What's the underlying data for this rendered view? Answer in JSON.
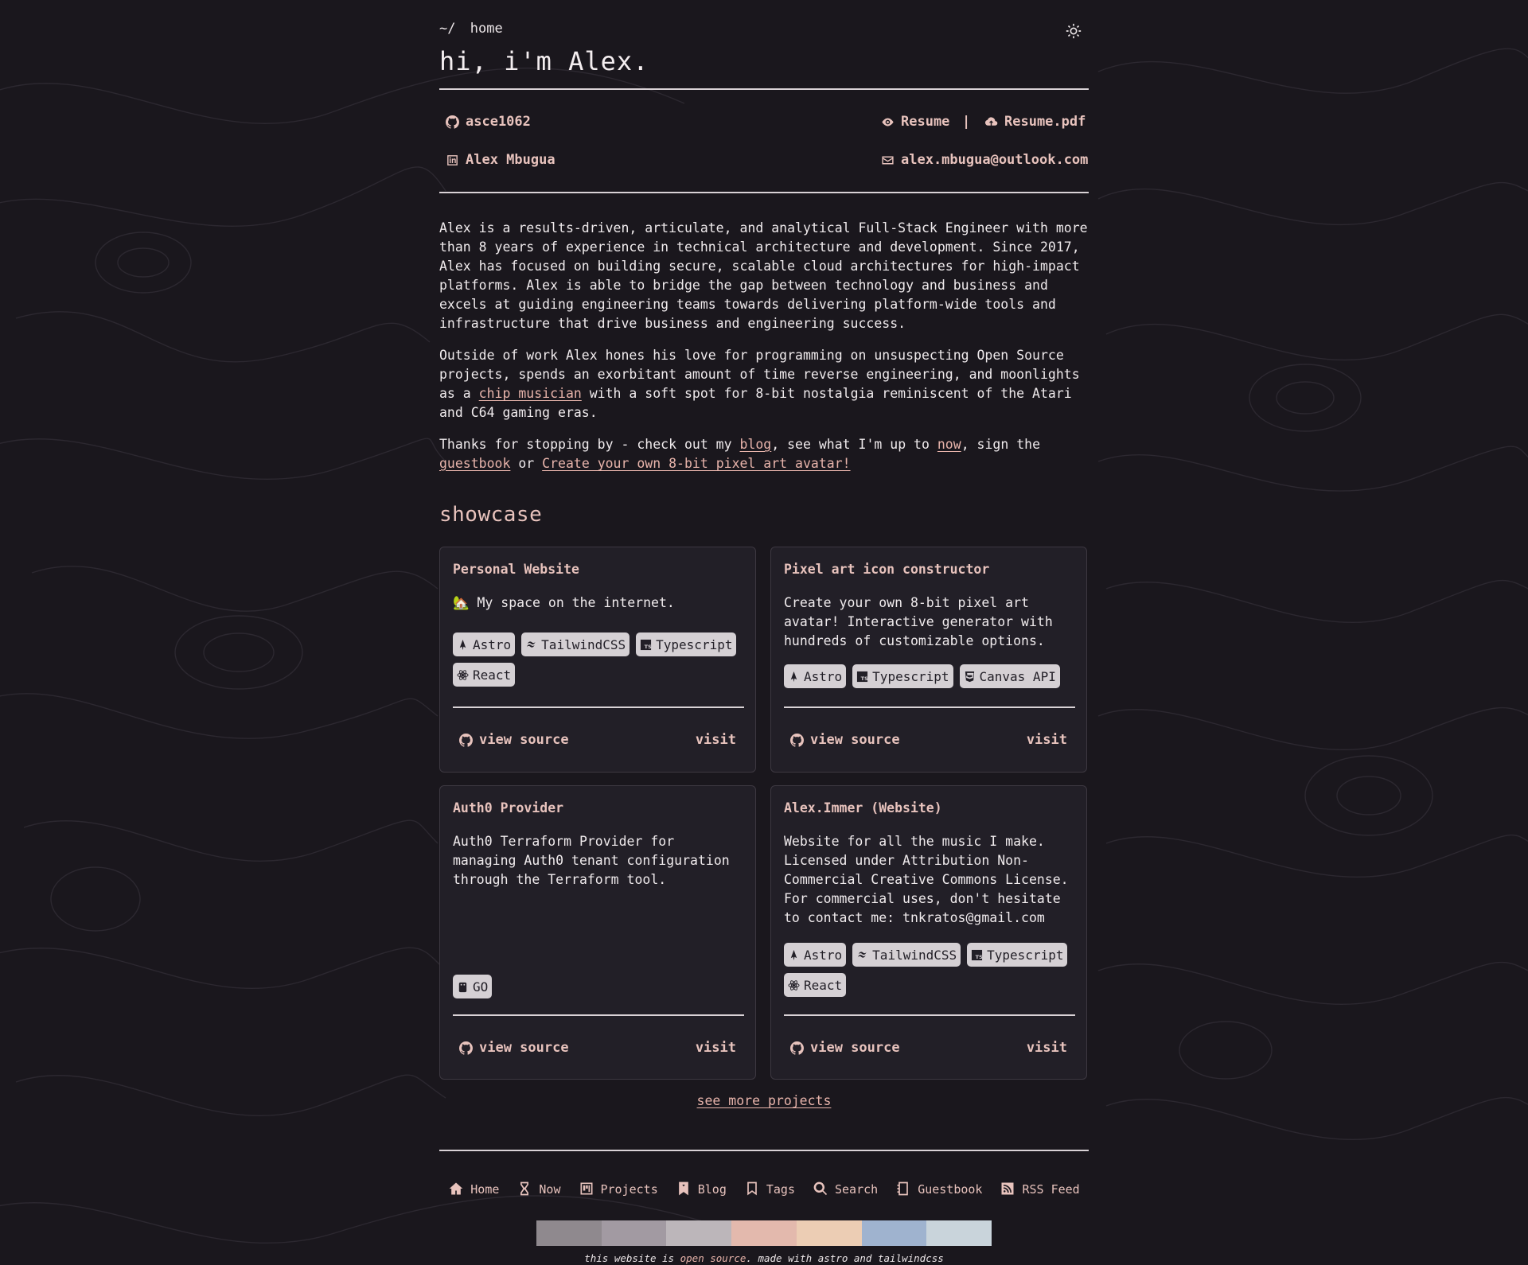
{
  "breadcrumb": {
    "prefix": "~/",
    "current": "home"
  },
  "header": {
    "title": "hi, i'm Alex."
  },
  "contacts": {
    "github": "asce1062",
    "resume": "Resume",
    "separator": "|",
    "resume_pdf": "Resume.pdf",
    "linkedin": "Alex Mbugua",
    "email": "alex.mbugua@outlook.com"
  },
  "about": {
    "p1": "Alex is a results-driven, articulate, and analytical Full-Stack Engineer with more than 8 years of experience in technical architecture and development. Since 2017, Alex has focused on building secure, scalable cloud architectures for high-impact platforms. Alex is able to bridge the gap between technology and business and excels at guiding engineering teams towards delivering platform-wide tools and infrastructure that drive business and engineering success.",
    "p2_a": "Outside of work Alex hones his love for programming on unsuspecting Open Source projects, spends an exorbitant amount of time reverse engineering, and moonlights as a ",
    "p2_link": "chip musician",
    "p2_b": " with a soft spot for 8-bit nostalgia reminiscent of the Atari and C64 gaming eras.",
    "p3_a": "Thanks for stopping by - check out my ",
    "p3_blog": "blog",
    "p3_b": ", see what I'm up to ",
    "p3_now": "now",
    "p3_c": ", sign the ",
    "p3_guestbook": "guestbook",
    "p3_d": " or ",
    "p3_avatar": "Create your own 8-bit pixel art avatar!"
  },
  "showcase": {
    "heading": "showcase",
    "cards": [
      {
        "title": "Personal Website",
        "description": "🏡 My space on the internet.",
        "tags": [
          "Astro",
          "TailwindCSS",
          "Typescript",
          "React"
        ],
        "source_label": "view source",
        "visit_label": "visit"
      },
      {
        "title": "Pixel art icon constructor",
        "description": "Create your own 8-bit pixel art avatar! Interactive generator with hundreds of customizable options.",
        "tags": [
          "Astro",
          "Typescript",
          "Canvas API"
        ],
        "source_label": "view source",
        "visit_label": "visit"
      },
      {
        "title": "Auth0 Provider",
        "description": "Auth0 Terraform Provider for managing Auth0 tenant configuration through the Terraform tool.",
        "tags": [
          "GO"
        ],
        "source_label": "view source",
        "visit_label": "visit"
      },
      {
        "title": "Alex.Immer (Website)",
        "description": "Website for all the music I make. Licensed under Attribution Non-Commercial Creative Commons License. For commercial uses, don't hesitate to contact me: tnkratos@gmail.com",
        "tags": [
          "Astro",
          "TailwindCSS",
          "Typescript",
          "React"
        ],
        "source_label": "view source",
        "visit_label": "visit"
      }
    ],
    "more_label": "see more projects"
  },
  "footer": {
    "nav": [
      "Home",
      "Now",
      "Projects",
      "Blog",
      "Tags",
      "Search",
      "Guestbook",
      "RSS Feed"
    ],
    "palette": [
      "#8f898e",
      "#a29aa2",
      "#bcb6ba",
      "#e3b9ad",
      "#eccdb4",
      "#9fb3cf",
      "#c9d4db"
    ],
    "note_a": "this website is ",
    "note_link": "open source",
    "note_b": ". made with astro and tailwindcss"
  },
  "colors": {
    "background": "#1a171d",
    "accent": "#e8c3bd",
    "link": "#e8b4ab",
    "card": "#221f27",
    "tag": "#d5d0d4"
  }
}
